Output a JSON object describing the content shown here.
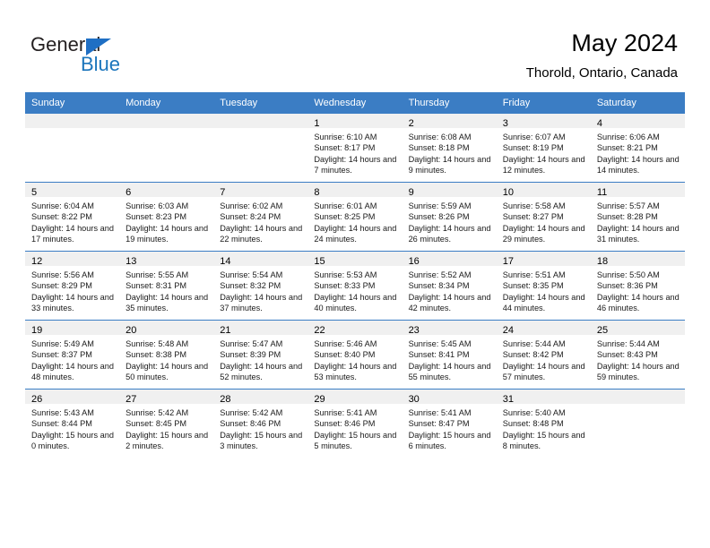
{
  "brand": {
    "name_top": "General",
    "name_bottom": "Blue",
    "accent_color": "#1b75bc",
    "triangle_color": "#1f6fc4"
  },
  "header": {
    "title": "May 2024",
    "subtitle": "Thorold, Ontario, Canada"
  },
  "calendar": {
    "header_bg": "#3b7dc4",
    "header_text_color": "#ffffff",
    "daynum_band_bg": "#f0f0f0",
    "weekday_headers": [
      "Sunday",
      "Monday",
      "Tuesday",
      "Wednesday",
      "Thursday",
      "Friday",
      "Saturday"
    ],
    "weeks": [
      [
        {
          "empty": true
        },
        {
          "empty": true
        },
        {
          "empty": true
        },
        {
          "day": "1",
          "sunrise": "Sunrise: 6:10 AM",
          "sunset": "Sunset: 8:17 PM",
          "daylight": "Daylight: 14 hours and 7 minutes."
        },
        {
          "day": "2",
          "sunrise": "Sunrise: 6:08 AM",
          "sunset": "Sunset: 8:18 PM",
          "daylight": "Daylight: 14 hours and 9 minutes."
        },
        {
          "day": "3",
          "sunrise": "Sunrise: 6:07 AM",
          "sunset": "Sunset: 8:19 PM",
          "daylight": "Daylight: 14 hours and 12 minutes."
        },
        {
          "day": "4",
          "sunrise": "Sunrise: 6:06 AM",
          "sunset": "Sunset: 8:21 PM",
          "daylight": "Daylight: 14 hours and 14 minutes."
        }
      ],
      [
        {
          "day": "5",
          "sunrise": "Sunrise: 6:04 AM",
          "sunset": "Sunset: 8:22 PM",
          "daylight": "Daylight: 14 hours and 17 minutes."
        },
        {
          "day": "6",
          "sunrise": "Sunrise: 6:03 AM",
          "sunset": "Sunset: 8:23 PM",
          "daylight": "Daylight: 14 hours and 19 minutes."
        },
        {
          "day": "7",
          "sunrise": "Sunrise: 6:02 AM",
          "sunset": "Sunset: 8:24 PM",
          "daylight": "Daylight: 14 hours and 22 minutes."
        },
        {
          "day": "8",
          "sunrise": "Sunrise: 6:01 AM",
          "sunset": "Sunset: 8:25 PM",
          "daylight": "Daylight: 14 hours and 24 minutes."
        },
        {
          "day": "9",
          "sunrise": "Sunrise: 5:59 AM",
          "sunset": "Sunset: 8:26 PM",
          "daylight": "Daylight: 14 hours and 26 minutes."
        },
        {
          "day": "10",
          "sunrise": "Sunrise: 5:58 AM",
          "sunset": "Sunset: 8:27 PM",
          "daylight": "Daylight: 14 hours and 29 minutes."
        },
        {
          "day": "11",
          "sunrise": "Sunrise: 5:57 AM",
          "sunset": "Sunset: 8:28 PM",
          "daylight": "Daylight: 14 hours and 31 minutes."
        }
      ],
      [
        {
          "day": "12",
          "sunrise": "Sunrise: 5:56 AM",
          "sunset": "Sunset: 8:29 PM",
          "daylight": "Daylight: 14 hours and 33 minutes."
        },
        {
          "day": "13",
          "sunrise": "Sunrise: 5:55 AM",
          "sunset": "Sunset: 8:31 PM",
          "daylight": "Daylight: 14 hours and 35 minutes."
        },
        {
          "day": "14",
          "sunrise": "Sunrise: 5:54 AM",
          "sunset": "Sunset: 8:32 PM",
          "daylight": "Daylight: 14 hours and 37 minutes."
        },
        {
          "day": "15",
          "sunrise": "Sunrise: 5:53 AM",
          "sunset": "Sunset: 8:33 PM",
          "daylight": "Daylight: 14 hours and 40 minutes."
        },
        {
          "day": "16",
          "sunrise": "Sunrise: 5:52 AM",
          "sunset": "Sunset: 8:34 PM",
          "daylight": "Daylight: 14 hours and 42 minutes."
        },
        {
          "day": "17",
          "sunrise": "Sunrise: 5:51 AM",
          "sunset": "Sunset: 8:35 PM",
          "daylight": "Daylight: 14 hours and 44 minutes."
        },
        {
          "day": "18",
          "sunrise": "Sunrise: 5:50 AM",
          "sunset": "Sunset: 8:36 PM",
          "daylight": "Daylight: 14 hours and 46 minutes."
        }
      ],
      [
        {
          "day": "19",
          "sunrise": "Sunrise: 5:49 AM",
          "sunset": "Sunset: 8:37 PM",
          "daylight": "Daylight: 14 hours and 48 minutes."
        },
        {
          "day": "20",
          "sunrise": "Sunrise: 5:48 AM",
          "sunset": "Sunset: 8:38 PM",
          "daylight": "Daylight: 14 hours and 50 minutes."
        },
        {
          "day": "21",
          "sunrise": "Sunrise: 5:47 AM",
          "sunset": "Sunset: 8:39 PM",
          "daylight": "Daylight: 14 hours and 52 minutes."
        },
        {
          "day": "22",
          "sunrise": "Sunrise: 5:46 AM",
          "sunset": "Sunset: 8:40 PM",
          "daylight": "Daylight: 14 hours and 53 minutes."
        },
        {
          "day": "23",
          "sunrise": "Sunrise: 5:45 AM",
          "sunset": "Sunset: 8:41 PM",
          "daylight": "Daylight: 14 hours and 55 minutes."
        },
        {
          "day": "24",
          "sunrise": "Sunrise: 5:44 AM",
          "sunset": "Sunset: 8:42 PM",
          "daylight": "Daylight: 14 hours and 57 minutes."
        },
        {
          "day": "25",
          "sunrise": "Sunrise: 5:44 AM",
          "sunset": "Sunset: 8:43 PM",
          "daylight": "Daylight: 14 hours and 59 minutes."
        }
      ],
      [
        {
          "day": "26",
          "sunrise": "Sunrise: 5:43 AM",
          "sunset": "Sunset: 8:44 PM",
          "daylight": "Daylight: 15 hours and 0 minutes."
        },
        {
          "day": "27",
          "sunrise": "Sunrise: 5:42 AM",
          "sunset": "Sunset: 8:45 PM",
          "daylight": "Daylight: 15 hours and 2 minutes."
        },
        {
          "day": "28",
          "sunrise": "Sunrise: 5:42 AM",
          "sunset": "Sunset: 8:46 PM",
          "daylight": "Daylight: 15 hours and 3 minutes."
        },
        {
          "day": "29",
          "sunrise": "Sunrise: 5:41 AM",
          "sunset": "Sunset: 8:46 PM",
          "daylight": "Daylight: 15 hours and 5 minutes."
        },
        {
          "day": "30",
          "sunrise": "Sunrise: 5:41 AM",
          "sunset": "Sunset: 8:47 PM",
          "daylight": "Daylight: 15 hours and 6 minutes."
        },
        {
          "day": "31",
          "sunrise": "Sunrise: 5:40 AM",
          "sunset": "Sunset: 8:48 PM",
          "daylight": "Daylight: 15 hours and 8 minutes."
        },
        {
          "empty": true
        }
      ]
    ]
  }
}
